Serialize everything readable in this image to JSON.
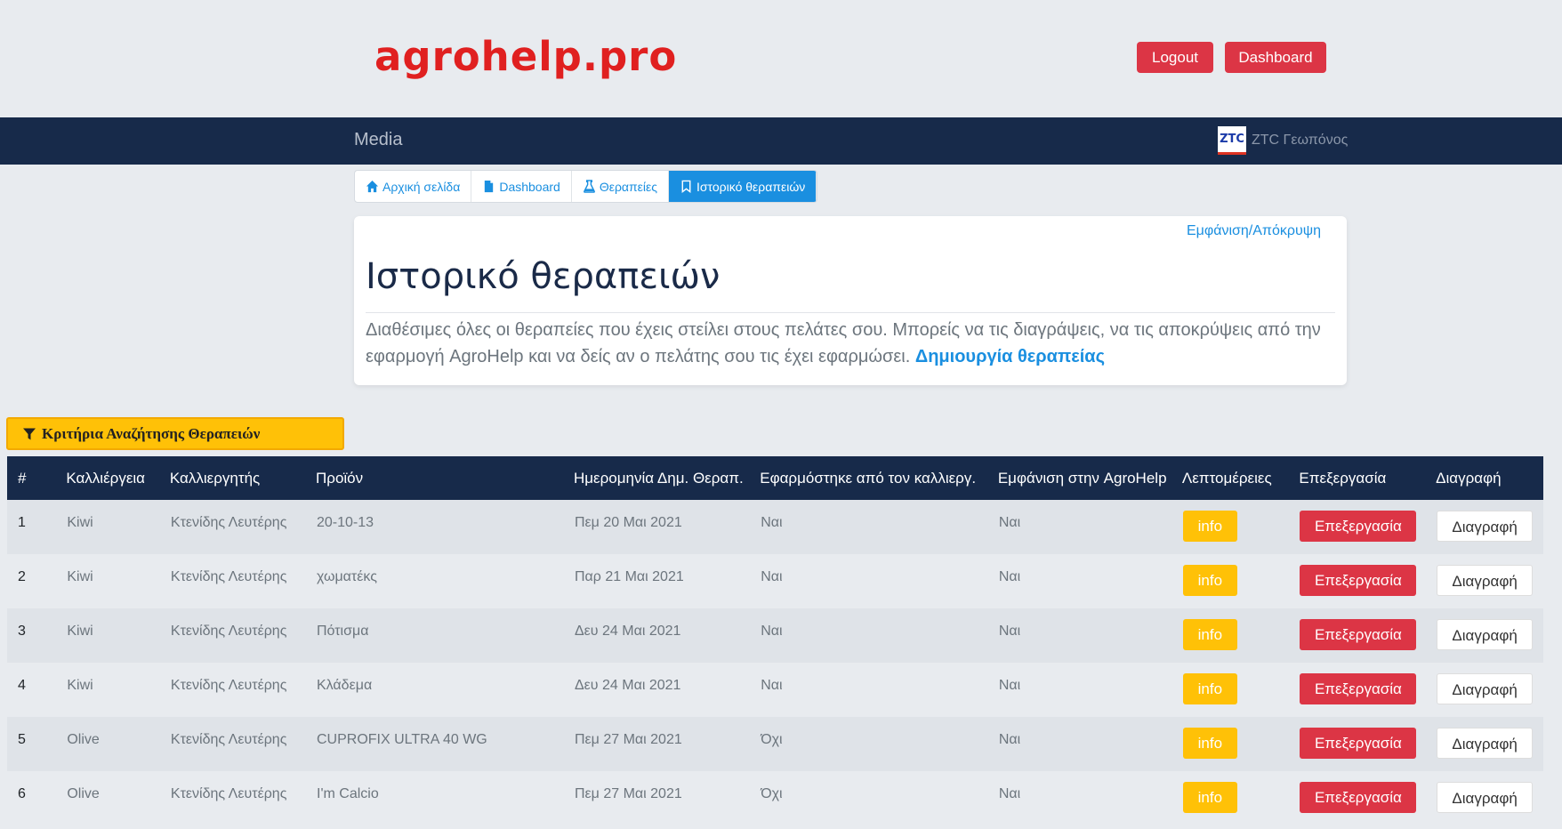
{
  "header": {
    "logo": "agrohelp.pro",
    "logout_label": "Logout",
    "dashboard_label": "Dashboard"
  },
  "navbar": {
    "brand": "Media",
    "user_logo": "ZTC",
    "user_name": "ZTC Γεωπόνος"
  },
  "tabs": [
    {
      "label": "Αρχική σελίδα",
      "icon": "home-icon"
    },
    {
      "label": "Dashboard",
      "icon": "file-icon"
    },
    {
      "label": "Θεραπείες",
      "icon": "flask-icon"
    },
    {
      "label": "Ιστορικό θεραπειών",
      "icon": "bookmark-icon",
      "active": true
    }
  ],
  "card": {
    "toggle_label": "Εμφάνιση/Απόκρυψη",
    "title": "Ιστορικό θεραπειών",
    "description": "Διαθέσιμες όλες οι θεραπείες που έχεις στείλει στους πελάτες σου. Μπορείς να τις διαγράψεις, να τις αποκρύψεις από την εφαρμογή AgroHelp και να δείς αν ο πελάτης σου τις έχει εφαρμώσει.",
    "create_link": "Δημιουργία θεραπείας"
  },
  "filter": {
    "label": "Κριτήρια Αναζήτησης Θεραπειών"
  },
  "table": {
    "columns": [
      "#",
      "Καλλιέργεια",
      "Καλλιεργητής",
      "Προϊόν",
      "Ημερομηνία Δημ. Θεραπ.",
      "Εφαρμόστηκε από τον καλλιεργ.",
      "Εμφάνιση στην AgroHelp",
      "Λεπτομέρειες",
      "Επεξεργασία",
      "Διαγραφή"
    ],
    "info_label": "info",
    "edit_label": "Επεξεργασία",
    "delete_label": "Διαγραφή",
    "rows": [
      {
        "num": "1",
        "crop": "Kiwi",
        "farmer": "Κτενίδης Λευτέρης",
        "product": "20-10-13",
        "date": "Πεμ 20 Μαι 2021",
        "applied": "Ναι",
        "visible": "Ναι"
      },
      {
        "num": "2",
        "crop": "Kiwi",
        "farmer": "Κτενίδης Λευτέρης",
        "product": "χωματέκς",
        "date": "Παρ 21 Μαι 2021",
        "applied": "Ναι",
        "visible": "Ναι"
      },
      {
        "num": "3",
        "crop": "Kiwi",
        "farmer": "Κτενίδης Λευτέρης",
        "product": "Πότισμα",
        "date": "Δευ 24 Μαι 2021",
        "applied": "Ναι",
        "visible": "Ναι"
      },
      {
        "num": "4",
        "crop": "Kiwi",
        "farmer": "Κτενίδης Λευτέρης",
        "product": "Κλάδεμα",
        "date": "Δευ 24 Μαι 2021",
        "applied": "Ναι",
        "visible": "Ναι"
      },
      {
        "num": "5",
        "crop": "Olive",
        "farmer": "Κτενίδης Λευτέρης",
        "product": "CUPROFIX ULTRA 40 WG",
        "date": "Πεμ 27 Μαι 2021",
        "applied": "Όχι",
        "visible": "Ναι"
      },
      {
        "num": "6",
        "crop": "Olive",
        "farmer": "Κτενίδης Λευτέρης",
        "product": "I'm Calcio",
        "date": "Πεμ 27 Μαι 2021",
        "applied": "Όχι",
        "visible": "Ναι"
      }
    ]
  },
  "colors": {
    "navbar": "#172a4a",
    "logo": "#e02020",
    "accent_blue": "#1a8fe0",
    "danger": "#dc3545",
    "warning": "#ffc107"
  }
}
